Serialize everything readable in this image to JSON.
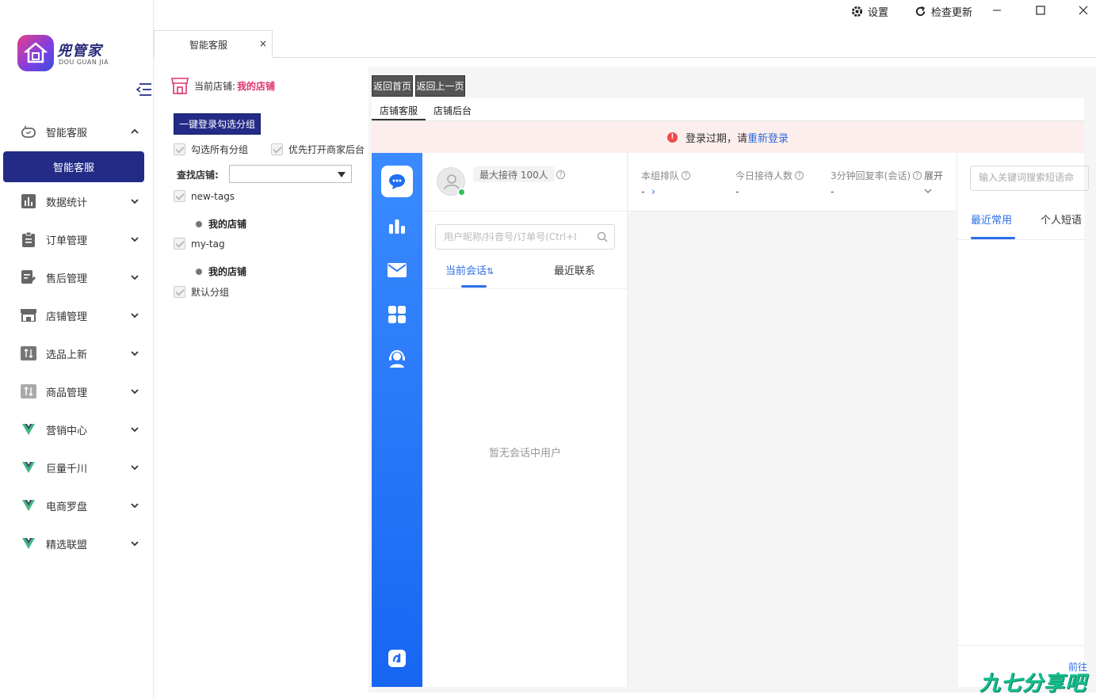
{
  "app": {
    "logo_text": "兜管家",
    "logo_sub": "DOU GUAN JIA"
  },
  "topbar": {
    "settings": "设置",
    "check_update": "检查更新"
  },
  "tabs": {
    "main_tab": "智能客服",
    "close": "×"
  },
  "sidebar": {
    "items": [
      {
        "label": "智能客服",
        "icon": "robot-icon"
      },
      {
        "label": "数据统计",
        "icon": "bar-chart-icon"
      },
      {
        "label": "订单管理",
        "icon": "clipboard-icon"
      },
      {
        "label": "售后管理",
        "icon": "edit-doc-icon"
      },
      {
        "label": "店铺管理",
        "icon": "store-icon"
      },
      {
        "label": "选品上新",
        "icon": "sort-icon"
      },
      {
        "label": "商品管理",
        "icon": "sort-icon"
      },
      {
        "label": "营销中心",
        "icon": "vue-icon"
      },
      {
        "label": "巨量千川",
        "icon": "vue-icon"
      },
      {
        "label": "电商罗盘",
        "icon": "vue-icon"
      },
      {
        "label": "精选联盟",
        "icon": "vue-icon"
      }
    ],
    "active_sub": "智能客服"
  },
  "store_panel": {
    "current_label": "当前店铺:",
    "current_store": "我的店铺",
    "login_group_btn": "一键登录勾选分组",
    "select_all_groups": "勾选所有分组",
    "prefer_open_backend": "优先打开商家后台",
    "find_store_label": "查找店铺:",
    "find_store_value": "",
    "groups": [
      {
        "name": "new-tags",
        "stores": [
          "我的店铺"
        ]
      },
      {
        "name": "my-tag",
        "stores": [
          "我的店铺"
        ]
      },
      {
        "name": "默认分组",
        "stores": []
      }
    ]
  },
  "nav": {
    "home": "返回首页",
    "back": "返回上一页"
  },
  "subtabs": [
    "店铺客服",
    "店铺后台"
  ],
  "alert": {
    "text": "登录过期，请",
    "link": "重新登录"
  },
  "conversation": {
    "max_receive": "最大接待 100人",
    "search_placeholder": "用户昵称/抖音号/订单号(Ctrl+I",
    "tab_current": "当前会话",
    "tab_current_sort": "⇅",
    "tab_recent": "最近联系",
    "empty_text": "暂无会话中用户"
  },
  "stats": [
    {
      "label": "本组排队",
      "value": "-"
    },
    {
      "label": "今日接待人数",
      "value": "-"
    },
    {
      "label": "3分钟回复率(会话)",
      "value": "-"
    }
  ],
  "stats_expand": "展开",
  "quick_reply": {
    "search_placeholder": "输入关键词搜索短语命",
    "tab_recent": "最近常用",
    "tab_personal": "个人短语",
    "prev": "前往"
  },
  "watermark": "九七分享吧",
  "colors": {
    "sidebar_active": "#232b86",
    "rail_blue": "#1766f2",
    "accent_blue": "#2b6fe8",
    "store_red": "#e0336b",
    "alert_bg": "#fdeeee"
  }
}
